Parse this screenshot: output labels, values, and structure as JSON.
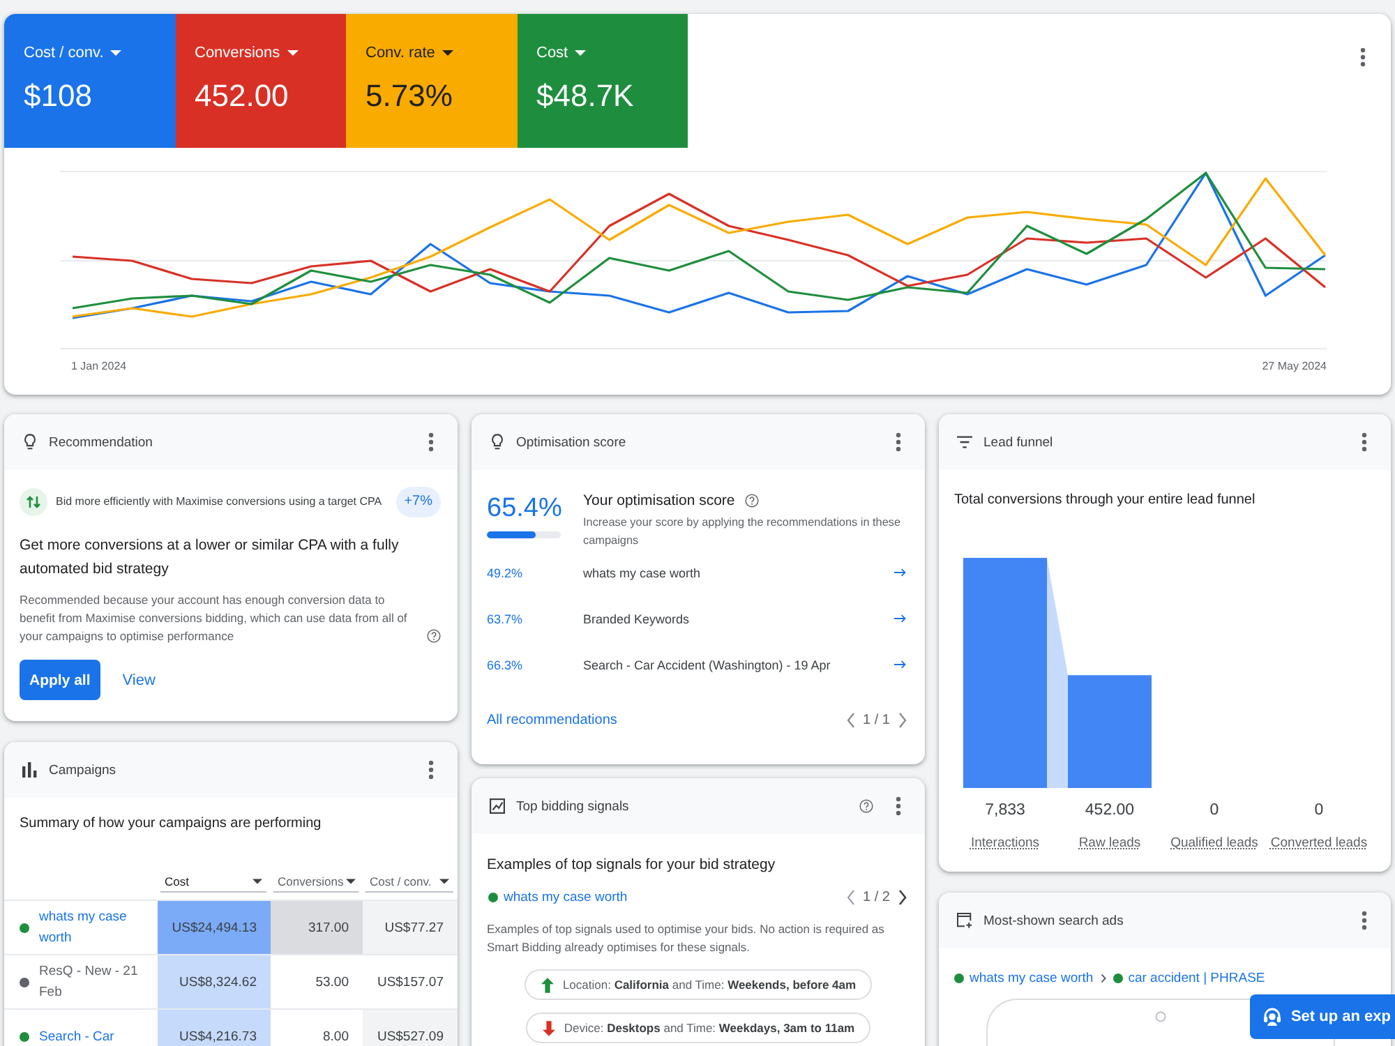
{
  "overview": {
    "metrics": [
      {
        "label": "Cost / conv.",
        "value": "$108",
        "color": "#1a73e8"
      },
      {
        "label": "Conversions",
        "value": "452.00",
        "color": "#d93025"
      },
      {
        "label": "Conv. rate",
        "value": "5.73%",
        "color": "#f9ab00"
      },
      {
        "label": "Cost",
        "value": "$48.7K",
        "color": "#1e8e3e"
      }
    ],
    "chart": {
      "start_label": "1 Jan 2024",
      "end_label": "27 May 2024"
    }
  },
  "recommendation_card": {
    "title": "Recommendation",
    "recommendation": "Bid more efficiently with Maximise conversions using a target CPA",
    "uplift": "+7%",
    "headline": "Get more conversions at a lower or similar CPA with a fully automated bid strategy",
    "reason": "Recommended because your account has enough conversion data to benefit from Maximise conversions bidding, which can use data from all of your campaigns to optimise performance",
    "buttons": [
      {
        "label": "Apply all",
        "kind": "primary"
      },
      {
        "label": "View",
        "kind": "text"
      }
    ]
  },
  "campaigns_card": {
    "title": "Campaigns",
    "summary": "Summary of how your campaigns are performing",
    "table": {
      "columns": [
        "Cost",
        "Conversions",
        "Cost / conv."
      ],
      "rows": [
        {
          "name": "whats my case worth",
          "color": "#1e8e3e",
          "paused": false,
          "cells": [
            {
              "text": "US$24,494.13",
              "color": "#7baaf7"
            },
            {
              "text": "317.00",
              "color": "#dadce0"
            },
            {
              "text": "US$77.27",
              "color": "#f1f3f4"
            }
          ]
        },
        {
          "name": "ResQ - New - 21 Feb",
          "color": "#5f6368",
          "paused": true,
          "cells": [
            {
              "text": "US$8,324.62",
              "color": "#c6dafc"
            },
            {
              "text": "53.00"
            },
            {
              "text": "US$157.07"
            }
          ]
        },
        {
          "name": "Search - Car",
          "color": "#1e8e3e",
          "paused": false,
          "cells": [
            {
              "text": "US$4,216.73",
              "color": "#c6dafc"
            },
            {
              "text": "8.00"
            },
            {
              "text": "US$527.09",
              "color": "#f1f3f4"
            }
          ]
        }
      ]
    }
  },
  "optimisation_card": {
    "title": "Optimisation score",
    "score": "65.4%",
    "level": 0.654,
    "heading": "Your optimisation score",
    "description": "Increase your score by applying the recommendations in these campaigns",
    "campaigns": [
      {
        "score": "49.2%",
        "name": "whats my case worth"
      },
      {
        "score": "63.7%",
        "name": "Branded Keywords"
      },
      {
        "score": "66.3%",
        "name": "Search - Car Accident (Washington) - 19 Apr"
      }
    ],
    "link": "All recommendations",
    "pagination": "1 / 1"
  },
  "bidding_card": {
    "title": "Top bidding signals",
    "heading": "Examples of top signals for your bid strategy",
    "campaign": {
      "name": "whats my case worth",
      "color": "#1e8e3e"
    },
    "pagination": "1 / 2",
    "description": "Examples of top signals used to optimise your bids. No action is required as Smart Bidding already optimises for these signals.",
    "signals": [
      {
        "positive": true,
        "text": "Location: **California** and Time: **Weekends, before 4am**"
      },
      {
        "positive": false,
        "text": "Device: **Desktops** and Time: **Weekdays, 3am to 11am**"
      }
    ]
  },
  "lead_funnel_card": {
    "title": "Lead funnel",
    "heading": "Total conversions through your entire lead funnel",
    "stages": [
      {
        "value": "7,833",
        "label": "Interactions"
      },
      {
        "value": "452.00",
        "label": "Raw leads"
      },
      {
        "value": "0",
        "label": "Qualified leads"
      },
      {
        "value": "0",
        "label": "Converted leads"
      }
    ]
  },
  "search_ads_card": {
    "title": "Most-shown search ads",
    "path": [
      {
        "text": "whats my case worth",
        "color": "#1e8e3e"
      },
      {
        "text": "car accident | PHRASE",
        "color": "#1e8e3e"
      }
    ]
  },
  "floating_button": {
    "label": "Set up an exp"
  }
}
